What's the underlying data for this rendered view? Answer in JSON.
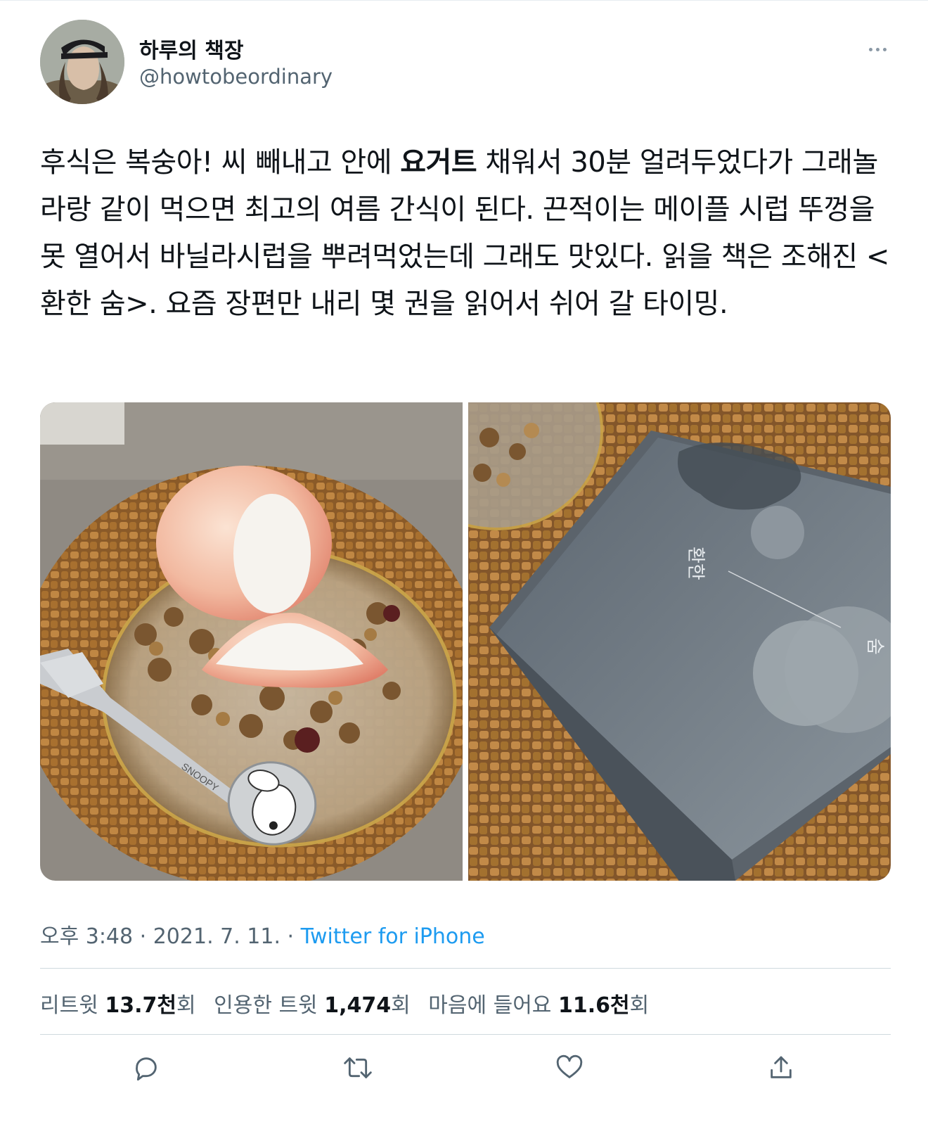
{
  "author": {
    "display_name": "하루의 책장",
    "handle": "@howtobeordinary"
  },
  "tweet": {
    "text_before_bold": "후식은 복숭아! 씨 빼내고 안에 ",
    "text_bold": "요거트",
    "text_after_bold": " 채워서 30분 얼려두었다가 그래놀라랑 같이 먹으면 최고의 여름 간식이 된다. 끈적이는 메이플 시럽 뚜껑을 못 열어서 바닐라시럽을 뿌려먹었는데 그래도 맛있다. 읽을 책은 조해진 <환한 숨>. 요즘 장편만 내리 몇 권을 읽어서 쉬어 갈 타이밍."
  },
  "photos": {
    "left_fork_engraving": "SNOOPY",
    "right_cover_title_1": "환한",
    "right_cover_title_2": "숨"
  },
  "meta": {
    "time": "오후 3:48",
    "sep1": " · ",
    "date": "2021. 7. 11.",
    "sep2": " · ",
    "source": "Twitter for iPhone"
  },
  "stats": {
    "retweets_label": "리트윗 ",
    "retweets_value": "13.7천",
    "retweets_unit": "회",
    "quotes_label": "인용한 트윗 ",
    "quotes_value": "1,474",
    "quotes_unit": "회",
    "likes_label": "마음에 들어요 ",
    "likes_value": "11.6천",
    "likes_unit": "회"
  },
  "icons": {
    "more": "more-horizontal-icon",
    "reply": "reply-icon",
    "retweet": "retweet-icon",
    "like": "heart-icon",
    "share": "share-icon"
  },
  "colors": {
    "link": "#1d9bf0",
    "secondary_text": "#536471",
    "divider": "#cfd9de"
  }
}
